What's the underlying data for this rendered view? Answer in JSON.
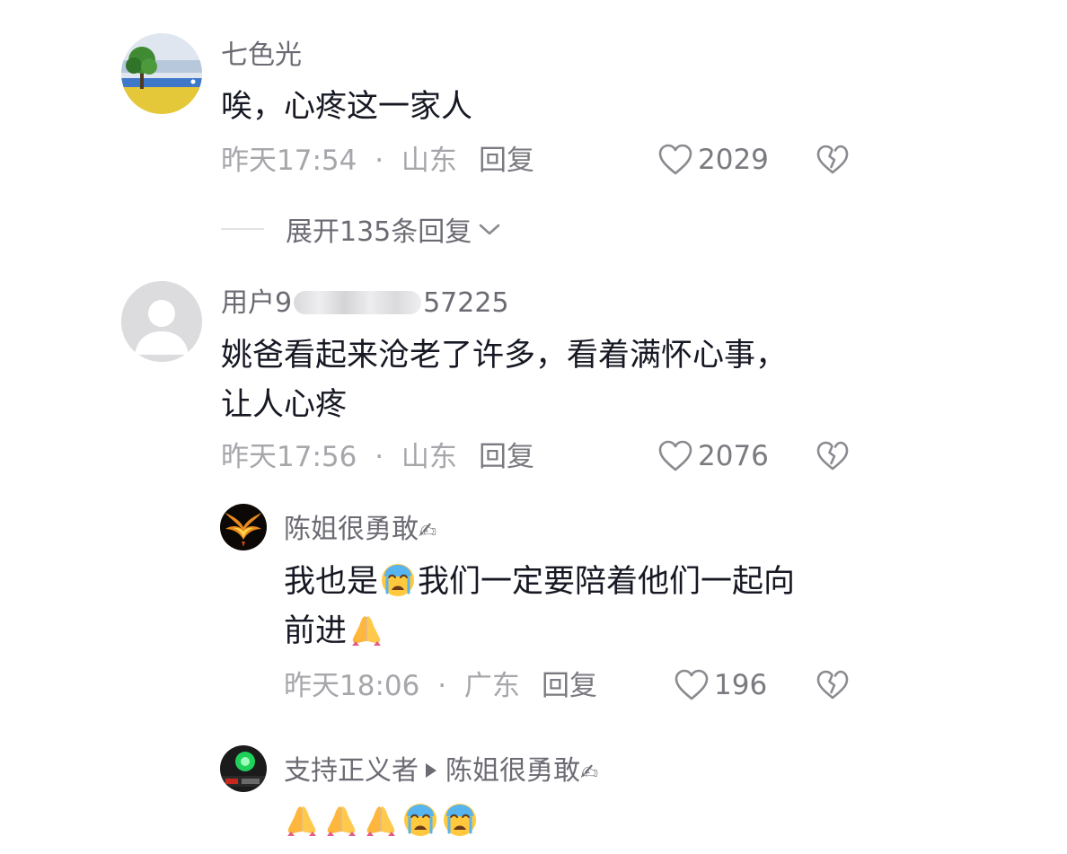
{
  "comments": [
    {
      "username": "七色光",
      "text": "唉，心疼这一家人",
      "time": "昨天17:54",
      "dot": "·",
      "location": "山东",
      "reply_label": "回复",
      "likes": "2029",
      "expand_label": "展开135条回复",
      "avatar": "landscape-tree-avatar"
    },
    {
      "username_prefix": "用户9",
      "username_suffix": "57225",
      "text_line1": "姚爸看起来沧老了许多，看着满怀心事，",
      "text_line2": "让人心疼",
      "time": "昨天17:56",
      "dot": "·",
      "location": "山东",
      "reply_label": "回复",
      "likes": "2076",
      "avatar": "default-user-avatar"
    }
  ],
  "replies": [
    {
      "username": "陈姐很勇敢",
      "write_icon": "✍",
      "text_part1": "我也是",
      "text_part2": "我们一定要陪着他们一起向",
      "text_line2": "前进",
      "time": "昨天18:06",
      "dot": "·",
      "location": "广东",
      "reply_label": "回复",
      "likes": "196",
      "avatar": "phoenix-avatar"
    },
    {
      "username": "支持正义者",
      "reply_to": "陈姐很勇敢",
      "write_icon": "✍",
      "emojis": [
        "pray",
        "pray",
        "pray",
        "crying",
        "crying"
      ],
      "avatar": "green-light-avatar"
    }
  ],
  "colors": {
    "primary_text": "#161823",
    "secondary_text": "#6b6b73",
    "meta_text": "#a6a6ab"
  }
}
